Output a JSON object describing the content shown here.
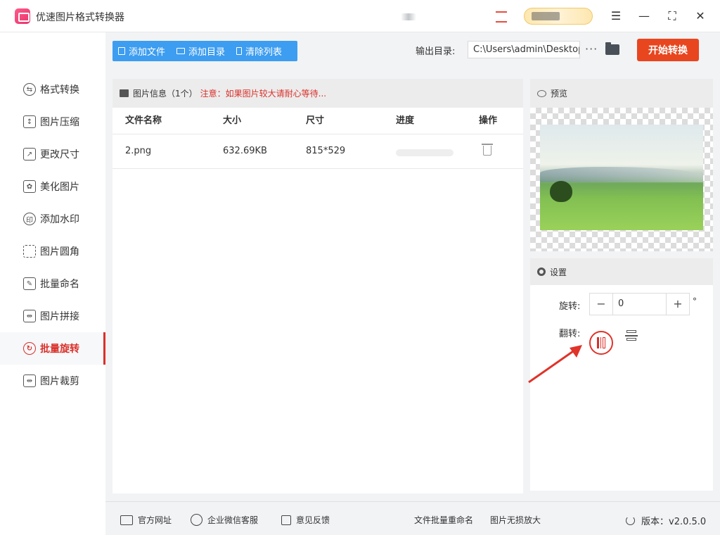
{
  "app": {
    "title": "优速图片格式转换器"
  },
  "sidebar": {
    "items": [
      {
        "label": "格式转换",
        "active": false
      },
      {
        "label": "图片压缩",
        "active": false
      },
      {
        "label": "更改尺寸",
        "active": false
      },
      {
        "label": "美化图片",
        "active": false
      },
      {
        "label": "添加水印",
        "active": false
      },
      {
        "label": "图片圆角",
        "active": false
      },
      {
        "label": "批量命名",
        "active": false
      },
      {
        "label": "图片拼接",
        "active": false
      },
      {
        "label": "批量旋转",
        "active": true
      },
      {
        "label": "图片裁剪",
        "active": false
      }
    ]
  },
  "toolbar": {
    "add_file": "添加文件",
    "add_dir": "添加目录",
    "clear_list": "清除列表",
    "output_label": "输出目录:",
    "output_path": "C:\\Users\\admin\\Desktop",
    "start": "开始转换"
  },
  "file_panel": {
    "header_title": "图片信息",
    "header_count": "（1个）",
    "warning": "注意：如果图片较大请耐心等待...",
    "columns": [
      "文件名称",
      "大小",
      "尺寸",
      "进度",
      "操作"
    ],
    "rows": [
      {
        "name": "2.png",
        "size": "632.69KB",
        "dims": "815*529",
        "progress": 0
      }
    ]
  },
  "preview": {
    "title": "预览"
  },
  "settings": {
    "title": "设置",
    "rotate_label": "旋转:",
    "rotate_value": "0",
    "degree": "°",
    "flip_label": "翻转:"
  },
  "footer": {
    "website": "官方网址",
    "wechat": "企业微信客服",
    "feedback": "意见反馈",
    "rename": "文件批量重命名",
    "enlarge": "图片无损放大",
    "version": "版本：v2.0.5.0"
  },
  "colors": {
    "accent": "#d9302a",
    "primary": "#3d9df0",
    "start": "#e8461f"
  }
}
